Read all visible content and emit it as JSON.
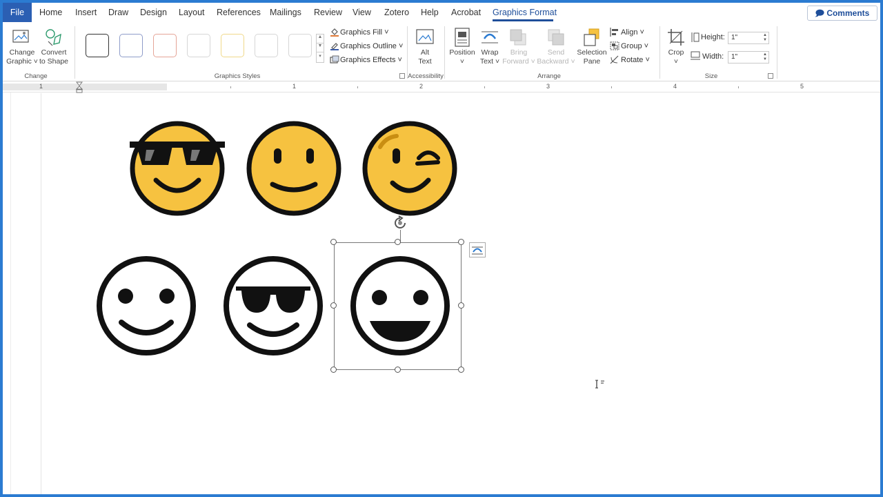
{
  "tabs": {
    "file": "File",
    "home": "Home",
    "insert": "Insert",
    "draw": "Draw",
    "design": "Design",
    "layout": "Layout",
    "references": "References",
    "mailings": "Mailings",
    "review": "Review",
    "view": "View",
    "zotero": "Zotero",
    "help": "Help",
    "acrobat": "Acrobat",
    "graphics_format": "Graphics Format"
  },
  "comments_label": "Comments",
  "ribbon": {
    "change": {
      "change_graphic_1": "Change",
      "change_graphic_2": "Graphic ˅",
      "convert_1": "Convert",
      "convert_2": "to Shape",
      "label": "Change"
    },
    "graphics_styles": {
      "fill": "Graphics Fill ˅",
      "outline": "Graphics Outline ˅",
      "effects": "Graphics Effects ˅",
      "label": "Graphics Styles",
      "swatches": [
        "#333333",
        "#8e9cc9",
        "#e5a497",
        "#cfcfcf",
        "#f0d98a",
        "#cfcfcf",
        "#cfcfcf"
      ]
    },
    "accessibility": {
      "alt_1": "Alt",
      "alt_2": "Text",
      "label": "Accessibility"
    },
    "arrange": {
      "position_1": "Position",
      "position_2": "˅",
      "wrap_1": "Wrap",
      "wrap_2": "Text ˅",
      "bring_1": "Bring",
      "bring_2": "Forward ˅",
      "send_1": "Send",
      "send_2": "Backward ˅",
      "selection_1": "Selection",
      "selection_2": "Pane",
      "align": "Align ˅",
      "group": "Group ˅",
      "rotate": "Rotate ˅",
      "label": "Arrange"
    },
    "size": {
      "crop_1": "Crop",
      "crop_2": "˅",
      "height_label": "Height:",
      "height_value": "1\"",
      "width_label": "Width:",
      "width_value": "1\"",
      "label": "Size"
    }
  },
  "ruler": {
    "numbers": [
      "1",
      "1",
      "2",
      "3",
      "4",
      "5"
    ]
  },
  "colors": {
    "accent": "#2b5fb3",
    "emoji_yellow": "#f6c240",
    "outline": "#111111"
  },
  "emojis": [
    "sunglasses-face-icon",
    "smiling-face-icon",
    "winking-face-icon",
    "smiling-face-outline-icon",
    "sunglasses-face-outline-icon",
    "grinning-face-outline-icon"
  ]
}
